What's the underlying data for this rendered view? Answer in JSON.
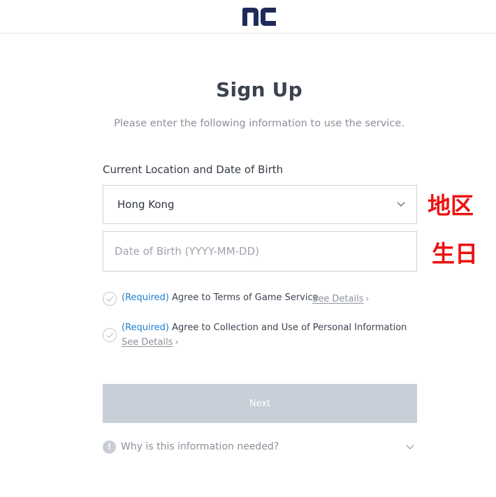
{
  "header": {
    "logo_icon": "nc-logo-icon",
    "logo_color": "#1f2a5a"
  },
  "main": {
    "title": "Sign Up",
    "subtitle": "Please enter the following information to use the service.",
    "section_label": "Current Location and Date of Birth",
    "location": {
      "value": "Hong Kong",
      "icon": "chevron-down-icon"
    },
    "dob": {
      "value": "",
      "placeholder": "Date of Birth (YYYY-MM-DD)"
    },
    "annotations": {
      "region": "地区",
      "birthday": "生日",
      "color": "#ee1111"
    },
    "agreements": [
      {
        "required": "(Required)",
        "text": "Agree to Terms of Game Service",
        "details": "See Details",
        "checked": false
      },
      {
        "required": "(Required)",
        "text": "Agree to Collection and Use of Personal Information",
        "details": "See Details",
        "checked": false
      }
    ],
    "next_button": {
      "label": "Next",
      "enabled": false,
      "color": "#c7d0d9"
    },
    "info": {
      "text": "Why is this information needed?",
      "icon": "exclamation-icon",
      "chevron": "chevron-down-icon"
    }
  },
  "colors": {
    "accent_required": "#1d7fd0",
    "text_primary": "#3c4350",
    "text_muted": "#8b9099",
    "border": "#cfd3d8"
  }
}
